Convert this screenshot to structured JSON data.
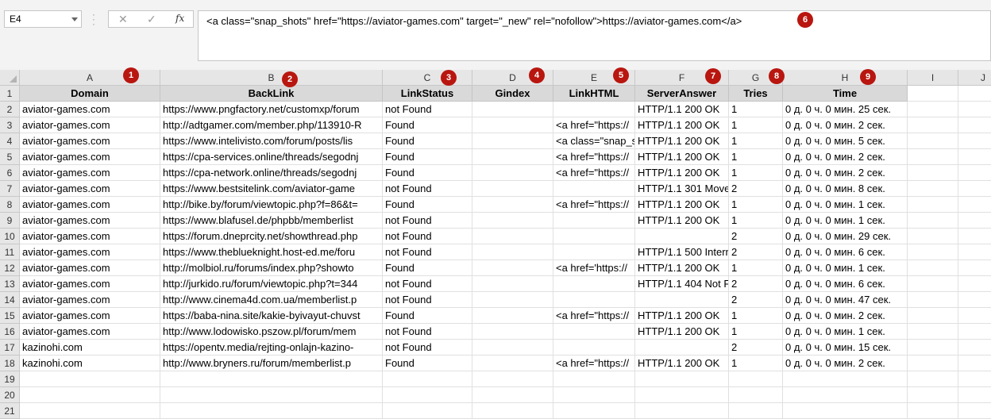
{
  "name_box": "E4",
  "formula_bar": {
    "cancel_icon": "close-icon",
    "enter_icon": "check-icon",
    "fx_label": "fx",
    "content": "<a class=\"snap_shots\" href=\"https://aviator-games.com\" target=\"_new\" rel=\"nofollow\">https://aviator-games.com</a>"
  },
  "columns": [
    "A",
    "B",
    "C",
    "D",
    "E",
    "F",
    "G",
    "H",
    "I",
    "J"
  ],
  "row_numbers": [
    "1",
    "2",
    "3",
    "4",
    "5",
    "6",
    "7",
    "8",
    "9",
    "10",
    "11",
    "12",
    "13",
    "14",
    "15",
    "16",
    "17",
    "18",
    "19",
    "20",
    "21"
  ],
  "headers": [
    "Domain",
    "BackLink",
    "LinkStatus",
    "Gindex",
    "LinkHTML",
    "ServerAnswer",
    "Tries",
    "Time"
  ],
  "rows": [
    [
      "aviator-games.com",
      "https://www.pngfactory.net/customxp/forum",
      "not Found",
      "",
      "",
      "HTTP/1.1 200 OK",
      "1",
      "0 д. 0 ч. 0 мин. 25 сек."
    ],
    [
      "aviator-games.com",
      "http://adtgamer.com/member.php/113910-R",
      "Found",
      "",
      "<a href=\"https://",
      "HTTP/1.1 200 OK",
      "1",
      "0 д. 0 ч. 0 мин. 2 сек."
    ],
    [
      "aviator-games.com",
      "https://www.intelivisto.com/forum/posts/lis",
      "Found",
      "",
      "<a class=\"snap_s",
      "HTTP/1.1 200 OK",
      "1",
      "0 д. 0 ч. 0 мин. 5 сек."
    ],
    [
      "aviator-games.com",
      "https://cpa-services.online/threads/segodnj",
      "Found",
      "",
      "<a href=\"https://",
      "HTTP/1.1 200 OK",
      "1",
      "0 д. 0 ч. 0 мин. 2 сек."
    ],
    [
      "aviator-games.com",
      "https://cpa-network.online/threads/segodnj",
      "Found",
      "",
      "<a href=\"https://",
      "HTTP/1.1 200 OK",
      "1",
      "0 д. 0 ч. 0 мин. 2 сек."
    ],
    [
      "aviator-games.com",
      "https://www.bestsitelink.com/aviator-game",
      "not Found",
      "",
      "",
      "HTTP/1.1 301 Move",
      "2",
      "0 д. 0 ч. 0 мин. 8 сек."
    ],
    [
      "aviator-games.com",
      "http://bike.by/forum/viewtopic.php?f=86&t=",
      "Found",
      "",
      "<a href=\"https://",
      "HTTP/1.1 200 OK",
      "1",
      "0 д. 0 ч. 0 мин. 1 сек."
    ],
    [
      "aviator-games.com",
      "https://www.blafusel.de/phpbb/memberlist",
      "not Found",
      "",
      "",
      "HTTP/1.1 200 OK",
      "1",
      "0 д. 0 ч. 0 мин. 1 сек."
    ],
    [
      "aviator-games.com",
      "https://forum.dneprcity.net/showthread.php",
      "not Found",
      "",
      "",
      "",
      "2",
      "0 д. 0 ч. 0 мин. 29 сек."
    ],
    [
      "aviator-games.com",
      "https://www.theblueknight.host-ed.me/foru",
      "not Found",
      "",
      "",
      "HTTP/1.1 500 Intern",
      "2",
      "0 д. 0 ч. 0 мин. 6 сек."
    ],
    [
      "aviator-games.com",
      "http://molbiol.ru/forums/index.php?showto",
      "Found",
      "",
      "<a href='https://",
      "HTTP/1.1 200 OK",
      "1",
      "0 д. 0 ч. 0 мин. 1 сек."
    ],
    [
      "aviator-games.com",
      "http://jurkido.ru/forum/viewtopic.php?t=344",
      "not Found",
      "",
      "",
      "HTTP/1.1 404 Not F",
      "2",
      "0 д. 0 ч. 0 мин. 6 сек."
    ],
    [
      "aviator-games.com",
      "http://www.cinema4d.com.ua/memberlist.p",
      "not Found",
      "",
      "",
      "",
      "2",
      "0 д. 0 ч. 0 мин. 47 сек."
    ],
    [
      "aviator-games.com",
      "https://baba-nina.site/kakie-byivayut-chuvst",
      "Found",
      "",
      "<a href=\"https://",
      "HTTP/1.1 200 OK",
      "1",
      "0 д. 0 ч. 0 мин. 2 сек."
    ],
    [
      "aviator-games.com",
      "http://www.lodowisko.pszow.pl/forum/mem",
      "not Found",
      "",
      "",
      "HTTP/1.1 200 OK",
      "1",
      "0 д. 0 ч. 0 мин. 1 сек."
    ],
    [
      "kazinohi.com",
      "https://opentv.media/rejting-onlajn-kazino-",
      "not Found",
      "",
      "",
      "",
      "2",
      "0 д. 0 ч. 0 мин. 15 сек."
    ],
    [
      "kazinohi.com",
      "http://www.bryners.ru/forum/memberlist.p",
      "Found",
      "",
      "<a href=\"https://",
      "HTTP/1.1 200 OK",
      "1",
      "0 д. 0 ч. 0 мин. 2 сек."
    ]
  ],
  "badges": [
    "1",
    "2",
    "3",
    "4",
    "5",
    "6",
    "7",
    "8",
    "9"
  ],
  "colors": {
    "badge": "#b8160f",
    "header_fill": "#d9d9d9",
    "grid_header": "#e6e6e6"
  }
}
